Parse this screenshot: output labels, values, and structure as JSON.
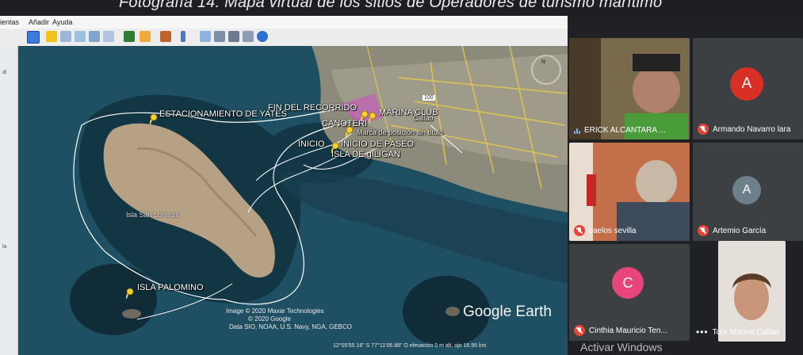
{
  "top_title": "Fotografía 14. Mapa virtual de los sitios de Operadores de turismo marítimo",
  "menu": {
    "items": [
      "ientas",
      "Añadir",
      "Ayuda"
    ]
  },
  "left_panel": {
    "labels": [
      "al",
      "la"
    ]
  },
  "map": {
    "labels": {
      "estacionamiento": "ESTACIONAMIENTO DE YATES",
      "fin_recorrido": "FIN DEL RECORRIDO",
      "marina_club": "MARINA CLUB",
      "canotaje": "CANOTERI",
      "marca": "Marca de posición sin título",
      "inicio": "INICIO",
      "inicio_paseo": "INICIO DE PASEO",
      "isla_gilligan": "ISLA DE gILIGAN",
      "isla_palomino": "ISLA PALOMINO",
      "isla_san_lorenzo": "Isla San Lorenzo",
      "callao": "Callao",
      "road_100": "100",
      "compass": "N"
    },
    "attribution": [
      "Image © 2020 Maxar Technologies",
      "© 2020 Google",
      "Data SIO, NOAA, U.S. Navy, NGA, GEBCO"
    ],
    "brand": "Google Earth",
    "status": "12°05'55.16\" S   77°11'06.86\" O   elevación   0 m   alt. ojo  16.95 km"
  },
  "participants": [
    {
      "name": "ERICK ALCANTARA ...",
      "type": "video",
      "speaking": true
    },
    {
      "name": "Armando Navarro lara",
      "initial": "A",
      "color": "#d93025",
      "muted": true
    },
    {
      "name": "caelos sevilla",
      "type": "video",
      "muted": true
    },
    {
      "name": "Artemio García",
      "initial": "A",
      "color": "#6e7f8c",
      "muted": true
    },
    {
      "name": "Cinthia Mauricio Ten...",
      "initial": "C",
      "color": "#e8457a",
      "muted": true
    },
    {
      "name": "Tour Marino Callao",
      "type": "video"
    }
  ],
  "watermark": "Activar Windows",
  "colors": {
    "sea": "#1f4758",
    "island": "#b59f80",
    "route": "#ffffff",
    "muted_red": "#ea4335"
  }
}
